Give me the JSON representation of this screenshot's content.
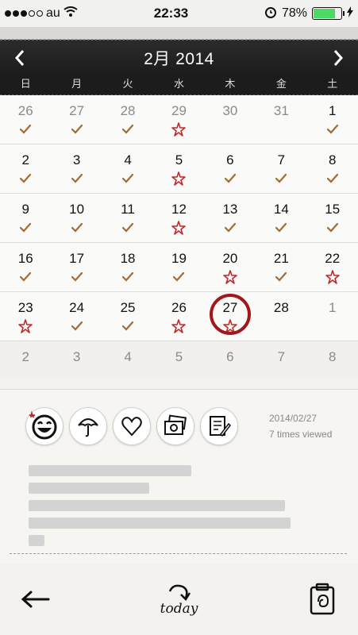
{
  "status_bar": {
    "carrier": "au",
    "time": "22:33",
    "battery": "78%"
  },
  "header": {
    "title": "2月 2014"
  },
  "weekdays": [
    "日",
    "月",
    "火",
    "水",
    "木",
    "金",
    "土"
  ],
  "weeks": [
    [
      {
        "d": "26",
        "m": "check",
        "o": true
      },
      {
        "d": "27",
        "m": "check",
        "o": true
      },
      {
        "d": "28",
        "m": "check",
        "o": true
      },
      {
        "d": "29",
        "m": "star",
        "o": true
      },
      {
        "d": "30",
        "m": "",
        "o": true
      },
      {
        "d": "31",
        "m": "",
        "o": true
      },
      {
        "d": "1",
        "m": "check",
        "o": false
      }
    ],
    [
      {
        "d": "2",
        "m": "check"
      },
      {
        "d": "3",
        "m": "check"
      },
      {
        "d": "4",
        "m": "check"
      },
      {
        "d": "5",
        "m": "star"
      },
      {
        "d": "6",
        "m": "check"
      },
      {
        "d": "7",
        "m": "check"
      },
      {
        "d": "8",
        "m": "check"
      }
    ],
    [
      {
        "d": "9",
        "m": "check"
      },
      {
        "d": "10",
        "m": "check"
      },
      {
        "d": "11",
        "m": "check"
      },
      {
        "d": "12",
        "m": "star"
      },
      {
        "d": "13",
        "m": "check"
      },
      {
        "d": "14",
        "m": "check"
      },
      {
        "d": "15",
        "m": "check"
      }
    ],
    [
      {
        "d": "16",
        "m": "check"
      },
      {
        "d": "17",
        "m": "check"
      },
      {
        "d": "18",
        "m": "check"
      },
      {
        "d": "19",
        "m": "check"
      },
      {
        "d": "20",
        "m": "star"
      },
      {
        "d": "21",
        "m": "check"
      },
      {
        "d": "22",
        "m": "star"
      }
    ],
    [
      {
        "d": "23",
        "m": "star"
      },
      {
        "d": "24",
        "m": "check"
      },
      {
        "d": "25",
        "m": "check"
      },
      {
        "d": "26",
        "m": "star"
      },
      {
        "d": "27",
        "m": "star",
        "today": true
      },
      {
        "d": "28",
        "m": ""
      },
      {
        "d": "1",
        "m": "",
        "o": true
      }
    ],
    [
      {
        "d": "2",
        "m": "",
        "o": true
      },
      {
        "d": "3",
        "m": "",
        "o": true
      },
      {
        "d": "4",
        "m": "",
        "o": true
      },
      {
        "d": "5",
        "m": "",
        "o": true
      },
      {
        "d": "6",
        "m": "",
        "o": true
      },
      {
        "d": "7",
        "m": "",
        "o": true
      },
      {
        "d": "8",
        "m": "",
        "o": true
      }
    ]
  ],
  "entry": {
    "date": "2014/02/27",
    "views": "7 times viewed"
  },
  "toolbar": {
    "today_label": "today"
  },
  "icons": [
    "smiley-icon",
    "umbrella-icon",
    "heart-icon",
    "photos-icon",
    "edit-note-icon"
  ],
  "colors": {
    "check": "#a36b33",
    "star": "#c0282d",
    "today_ring": "#a3161b",
    "battery": "#4cd964"
  }
}
